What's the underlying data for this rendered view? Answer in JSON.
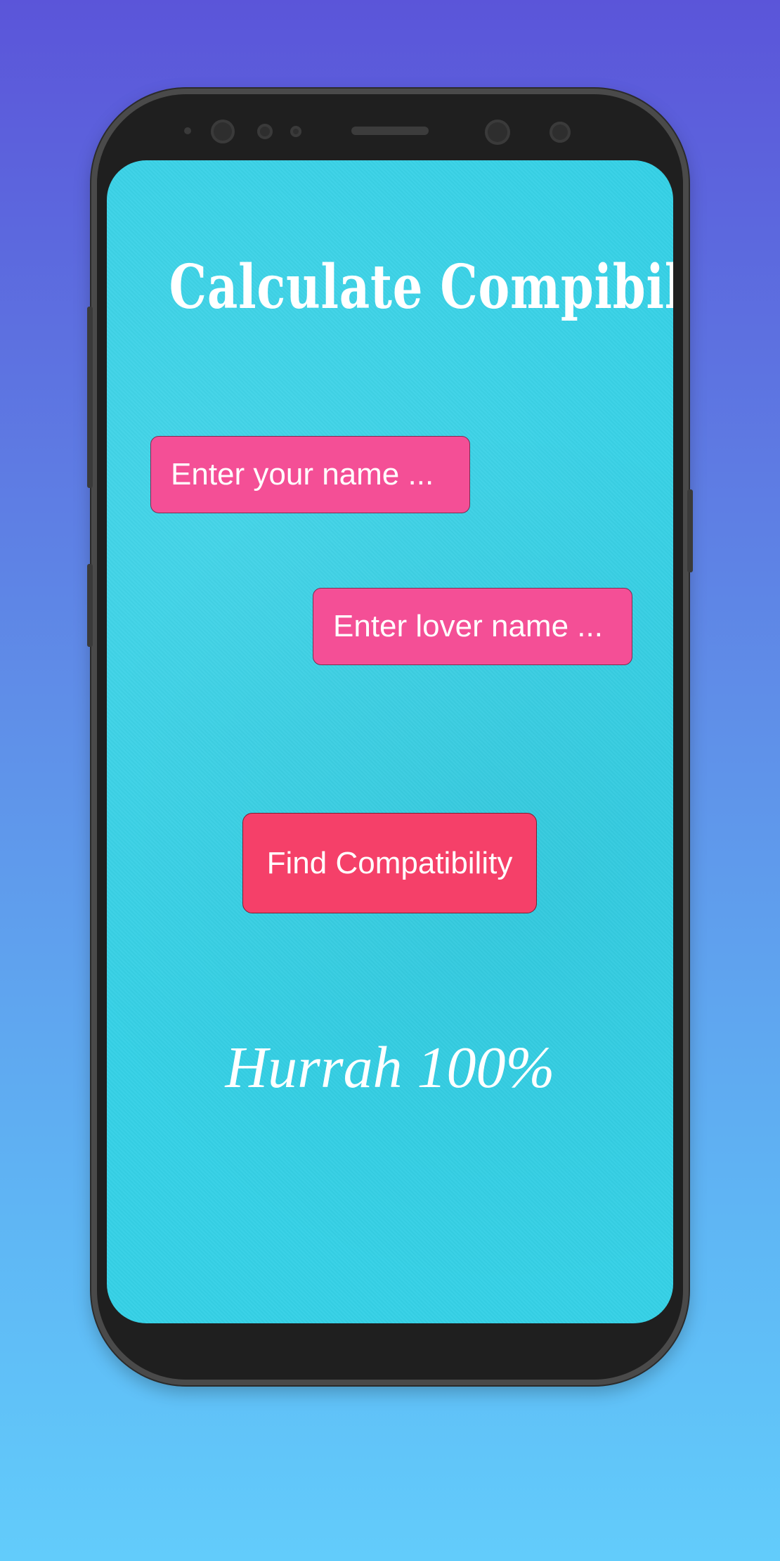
{
  "app": {
    "title": "Calculate  Compibility",
    "name_input": {
      "placeholder": "Enter your name ..."
    },
    "lover_input": {
      "placeholder": "Enter lover name ..."
    },
    "find_button_label": "Find Compatibility",
    "result_text": "Hurrah 100%"
  },
  "colors": {
    "background_top": "#5b55d9",
    "background_bottom": "#62ccfb",
    "screen": "#35d1e6",
    "input_fill": "#f44f96",
    "button_fill": "#f54069",
    "text": "#ffffff"
  }
}
